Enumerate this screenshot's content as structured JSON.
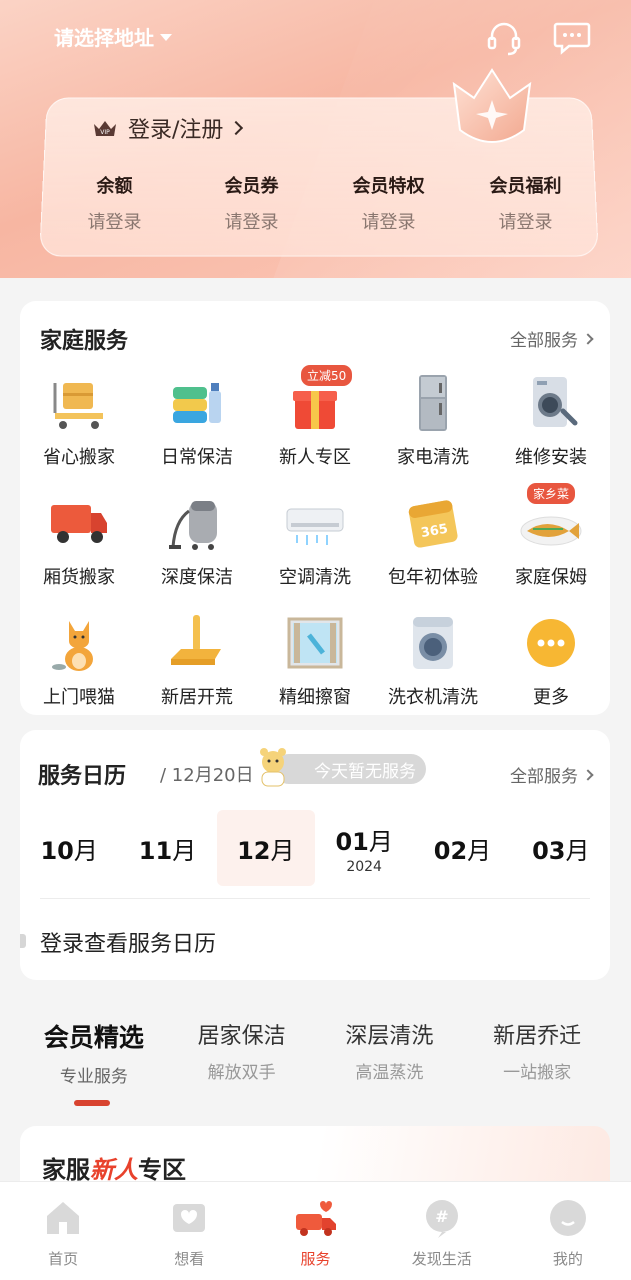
{
  "header": {
    "address": "请选择地址",
    "icons": [
      "headset-icon",
      "message-icon"
    ]
  },
  "vip": {
    "login_label": "登录/注册",
    "badge": "VIP",
    "stats": [
      {
        "label": "余额",
        "value": "请登录"
      },
      {
        "label": "会员券",
        "value": "请登录"
      },
      {
        "label": "会员特权",
        "value": "请登录"
      },
      {
        "label": "会员福利",
        "value": "请登录"
      }
    ]
  },
  "home_service": {
    "title": "家庭服务",
    "more": "全部服务",
    "items": [
      {
        "label": "省心搬家",
        "icon": "moving-cart-icon"
      },
      {
        "label": "日常保洁",
        "icon": "towels-icon"
      },
      {
        "label": "新人专区",
        "icon": "gift-box-icon",
        "badge": "立减50"
      },
      {
        "label": "家电清洗",
        "icon": "fridge-icon"
      },
      {
        "label": "维修安装",
        "icon": "washer-wrench-icon"
      },
      {
        "label": "厢货搬家",
        "icon": "truck-icon"
      },
      {
        "label": "深度保洁",
        "icon": "vacuum-icon"
      },
      {
        "label": "空调清洗",
        "icon": "air-conditioner-icon"
      },
      {
        "label": "包年初体验",
        "icon": "calendar-365-icon"
      },
      {
        "label": "家庭保姆",
        "icon": "fish-dish-icon",
        "badge": "家乡菜"
      },
      {
        "label": "上门喂猫",
        "icon": "cat-icon"
      },
      {
        "label": "新居开荒",
        "icon": "mop-icon"
      },
      {
        "label": "精细擦窗",
        "icon": "window-icon"
      },
      {
        "label": "洗衣机清洗",
        "icon": "washing-machine-icon"
      },
      {
        "label": "更多",
        "icon": "more-icon"
      }
    ]
  },
  "calendar": {
    "title": "服务日历",
    "date": "/ 12月20日",
    "status": "今天暂无服务",
    "more": "全部服务",
    "months": [
      {
        "num": "10",
        "unit": "月",
        "year": ""
      },
      {
        "num": "11",
        "unit": "月",
        "year": ""
      },
      {
        "num": "12",
        "unit": "月",
        "year": "",
        "active": true
      },
      {
        "num": "01",
        "unit": "月",
        "year": "2024"
      },
      {
        "num": "02",
        "unit": "月",
        "year": ""
      },
      {
        "num": "03",
        "unit": "月",
        "year": ""
      }
    ],
    "login_prompt": "登录查看服务日历"
  },
  "tabs": [
    {
      "title": "会员精选",
      "sub": "专业服务",
      "active": true
    },
    {
      "title": "居家保洁",
      "sub": "解放双手"
    },
    {
      "title": "深层清洗",
      "sub": "高温蒸洗"
    },
    {
      "title": "新居乔迁",
      "sub": "一站搬家"
    }
  ],
  "newbie": {
    "prefix": "家服",
    "highlight": "新人",
    "suffix": "专区"
  },
  "bottom_nav": [
    {
      "label": "首页",
      "icon": "home-icon"
    },
    {
      "label": "想看",
      "icon": "heart-card-icon"
    },
    {
      "label": "服务",
      "icon": "service-truck-icon",
      "active": true
    },
    {
      "label": "发现生活",
      "icon": "hashtag-icon"
    },
    {
      "label": "我的",
      "icon": "profile-icon"
    }
  ],
  "colors": {
    "accent": "#e8422c",
    "hero": "#f7b6a2"
  }
}
